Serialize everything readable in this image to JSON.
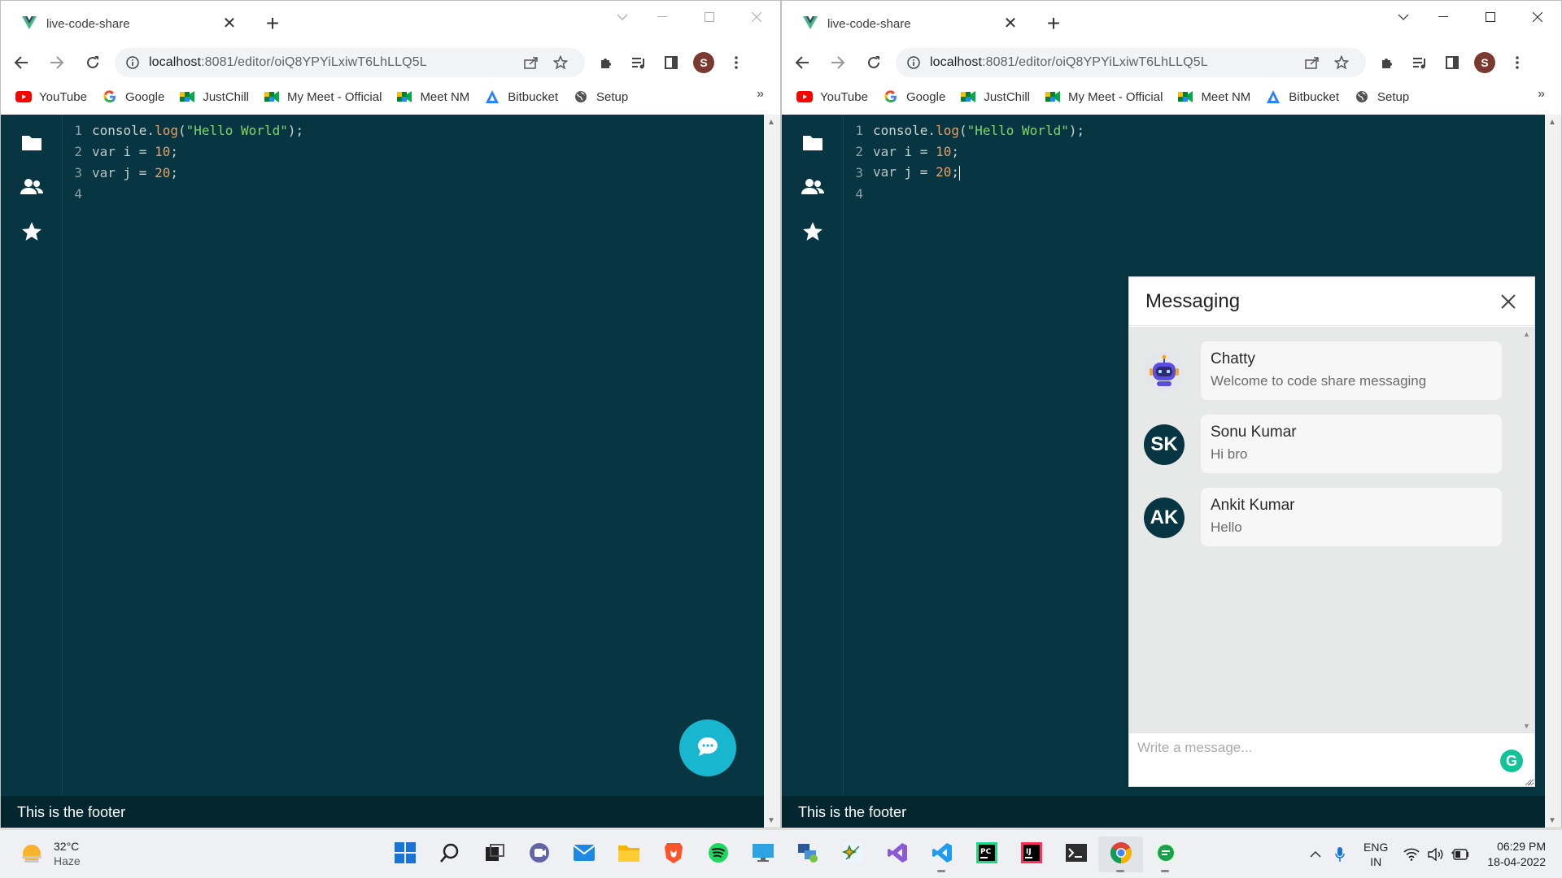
{
  "browser": {
    "tab_title": "live-code-share",
    "url_host": "localhost",
    "url_path": ":8081/editor/oiQ8YPYiLxiwT6LhLLQ5L",
    "profile_initial": "S",
    "bookmarks": [
      {
        "label": "YouTube",
        "icon": "youtube-icon"
      },
      {
        "label": "Google",
        "icon": "google-icon"
      },
      {
        "label": "JustChill",
        "icon": "meet-icon"
      },
      {
        "label": "My Meet - Official",
        "icon": "meet-icon"
      },
      {
        "label": "Meet NM",
        "icon": "meet-icon"
      },
      {
        "label": "Bitbucket",
        "icon": "bitbucket-icon"
      },
      {
        "label": "Setup",
        "icon": "globe-icon"
      }
    ],
    "bookmarks_more": "»"
  },
  "editor": {
    "lines": [
      {
        "n": "1",
        "a": "console.",
        "fn": "log",
        "b": "(",
        "str": "\"Hello World\"",
        "c": ");"
      },
      {
        "n": "2",
        "kw": "var",
        "mid": " i = ",
        "num": "10",
        "end": ";"
      },
      {
        "n": "3",
        "kw": "var",
        "mid": " j = ",
        "num": "20",
        "end": ";"
      },
      {
        "n": "4"
      }
    ]
  },
  "footer": {
    "text": "This is the footer"
  },
  "messaging": {
    "title": "Messaging",
    "conversations": [
      {
        "name": "Chatty",
        "preview": "Welcome to code share messaging",
        "avatar": "robot-icon"
      },
      {
        "name": "Sonu Kumar",
        "preview": "Hi bro",
        "initials": "SK"
      },
      {
        "name": "Ankit Kumar",
        "preview": "Hello",
        "initials": "AK"
      }
    ],
    "input_placeholder": "Write a message...",
    "grammarly_letter": "G"
  },
  "taskbar": {
    "weather_temp": "32°C",
    "weather_desc": "Haze",
    "lang_top": "ENG",
    "lang_bottom": "IN",
    "time": "06:29 PM",
    "date": "18-04-2022"
  }
}
